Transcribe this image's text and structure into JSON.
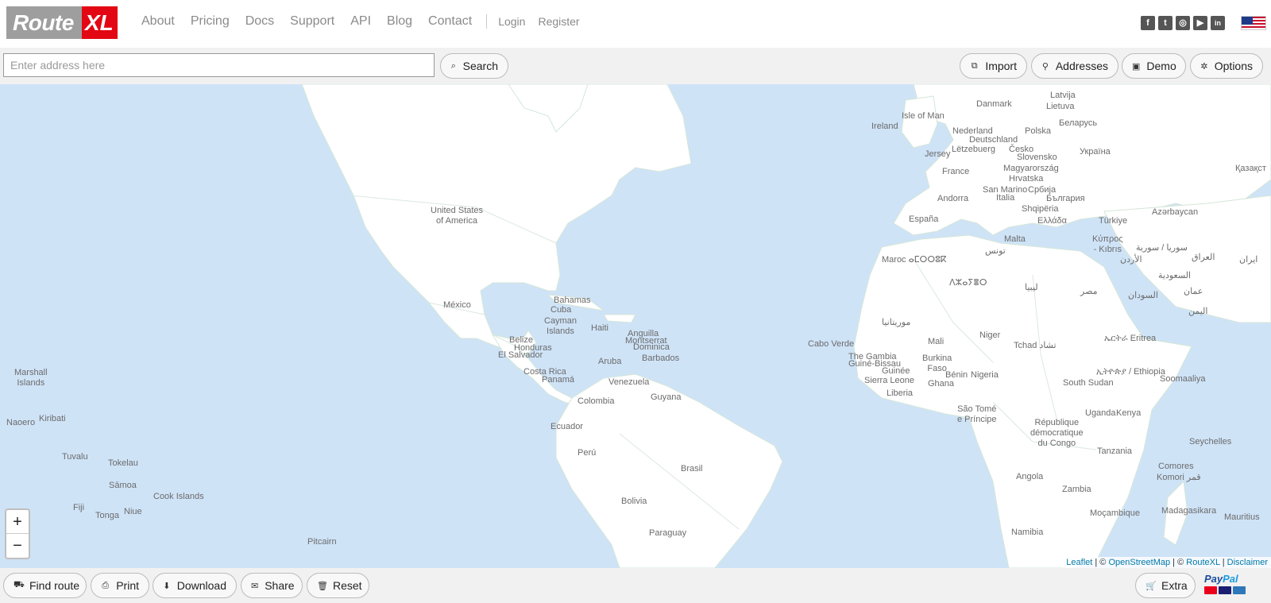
{
  "brand": {
    "route": "Route",
    "xl": "XL"
  },
  "nav": {
    "about": "About",
    "pricing": "Pricing",
    "docs": "Docs",
    "support": "Support",
    "api": "API",
    "blog": "Blog",
    "contact": "Contact",
    "login": "Login",
    "register": "Register"
  },
  "social": {
    "facebook": "f",
    "twitter": "t",
    "instagram": "◎",
    "youtube": "▶",
    "linkedin": "in"
  },
  "search": {
    "placeholder": "Enter address here",
    "button": "Search"
  },
  "toolbar": {
    "import": "Import",
    "addresses": "Addresses",
    "demo": "Demo",
    "options": "Options"
  },
  "map": {
    "labels": {
      "usa": "United States\nof America",
      "mexico": "México",
      "bahamas": "Bahamas",
      "cuba": "Cuba",
      "cayman": "Cayman\nIslands",
      "haiti": "Haiti",
      "belize": "Belize",
      "honduras": "Honduras",
      "elsalvador": "El Salvador",
      "costarica": "Costa Rica",
      "panama": "Panamá",
      "anguilla": "Anguilla",
      "montserrat": "Montserrat",
      "dominica": "Dominica",
      "aruba": "Aruba",
      "barbados": "Barbados",
      "venezuela": "Venezuela",
      "guyana": "Guyana",
      "colombia": "Colombia",
      "ecuador": "Ecuador",
      "peru": "Perú",
      "brasil": "Brasil",
      "bolivia": "Bolivia",
      "paraguay": "Paraguay",
      "marshall": "Marshall\nIslands",
      "kiribati": "Kiribati",
      "naoero": "Naoero",
      "tuvalu": "Tuvalu",
      "tokelau": "Tokelau",
      "samoa": "Sāmoa",
      "cook": "Cook Islands",
      "tonga": "Tonga",
      "niue": "Niue",
      "fiji": "Fiji",
      "pitcairn": "Pitcairn",
      "latvija": "Latvija",
      "danmark": "Danmark",
      "lietuva": "Lietuva",
      "isleofman": "Isle of Man",
      "ireland": "Ireland",
      "nederland": "Nederland",
      "polska": "Polska",
      "belarus": "Беларусь",
      "deutschland": "Deutschland",
      "jersey": "Jersey",
      "letzebuerg": "Lëtzebuerg",
      "cesko": "Česko",
      "slovensko": "Slovensko",
      "ukraina": "Україна",
      "france": "France",
      "magyar": "Magyarország",
      "hrvatska": "Hrvatska",
      "kazakhstan": "Қазақст",
      "andorra": "Andorra",
      "sanmarino": "San Marino",
      "srbija": "Србија",
      "italia": "Italia",
      "bulgaria": "България",
      "shqiperia": "Shqipëria",
      "espana": "España",
      "ellada": "Ελλάδα",
      "turkiye": "Türkiye",
      "azerbaycan": "Azərbaycan",
      "malta": "Malta",
      "kypros": "Κύπρος\n- Kıbrıs",
      "maroc": "Maroc ⴰⵎⵔⵔⵓⴽ",
      "mali": "Mali",
      "niger": "Niger",
      "tchad": "Tchad تشاد",
      "caboverde": "Cabo Verde",
      "gambia": "The Gambia",
      "guineebissau": "Guiné-Bissau",
      "guinee": "Guinée",
      "burkina": "Burkina\nFaso",
      "benin": "Bénin",
      "nigeria": "Nigeria",
      "sierraleone": "Sierra Leone",
      "ghana": "Ghana",
      "liberia": "Liberia",
      "eritrea": "ኤርትራ Eritrea",
      "ethiopia": "ኢትዮጵያ / Ethiopia",
      "southsudan": "South Sudan",
      "uganda": "Uganda",
      "kenya": "Kenya",
      "saotome": "São Tomé\ne Príncipe",
      "rdc": "République\ndémocratique\ndu Congo",
      "tanzania": "Tanzania",
      "seychelles": "Seychelles",
      "comores": "Comores",
      "komori": "Komori ﻗﻤﺮ",
      "angola": "Angola",
      "zambia": "Zambia",
      "mozambique": "Moçambique",
      "madagascar": "Madagasikara",
      "mauritius": "Mauritius",
      "namibia": "Namibia",
      "libya": "ليبيا",
      "egypt": "مصر",
      "sudan": "السودان",
      "algeria": "ⴷⵣⴰⵢⴻⵔ",
      "mauritanie": "موريتانيا",
      "saudi": "السعودية",
      "iraq": "العراق",
      "iran": "ایران",
      "oman": "عمان",
      "yemen": "اليمن",
      "syria": "سوريا / سورية",
      "jordan": "الأردن",
      "tunisia": "تونس",
      "somalia": "Soomaaliya"
    },
    "attribution": {
      "leaflet": "Leaflet",
      "osm": "OpenStreetMap",
      "routexl": "RouteXL",
      "disclaimer": "Disclaimer",
      "sep1": " | © ",
      "sep2": " | © ",
      "sep3": " | "
    }
  },
  "footer": {
    "find_route": "Find route",
    "print": "Print",
    "download": "Download",
    "share": "Share",
    "reset": "Reset",
    "extra": "Extra",
    "paypal_pay": "Pay",
    "paypal_pal": "Pal"
  }
}
